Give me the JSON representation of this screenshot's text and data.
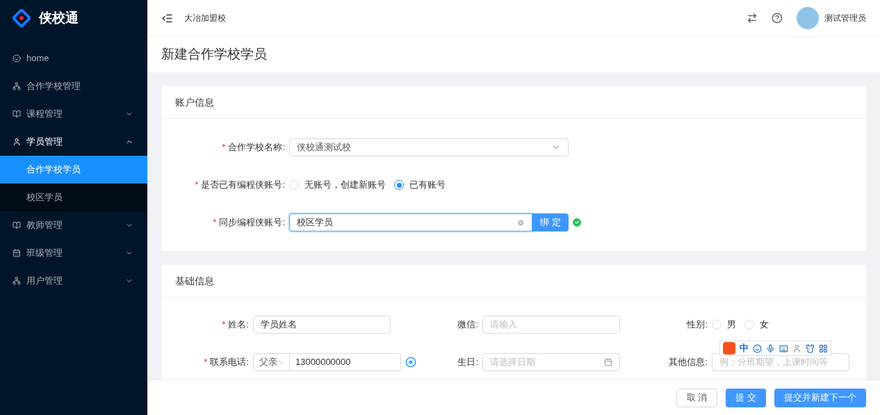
{
  "sidebar": {
    "logo": "侠校通",
    "items": [
      {
        "label": "home",
        "has_children": false,
        "expanded": false,
        "selected": false
      },
      {
        "label": "合作学校管理",
        "has_children": false,
        "expanded": false,
        "selected": false
      },
      {
        "label": "课程管理",
        "has_children": true,
        "expanded": false,
        "selected": false
      },
      {
        "label": "学员管理",
        "has_children": true,
        "expanded": true,
        "selected": false,
        "children": [
          {
            "label": "合作学校学员",
            "selected": true
          },
          {
            "label": "校区学员",
            "selected": false
          }
        ]
      },
      {
        "label": "教师管理",
        "has_children": true,
        "expanded": false,
        "selected": false
      },
      {
        "label": "班级管理",
        "has_children": true,
        "expanded": false,
        "selected": false
      },
      {
        "label": "用户管理",
        "has_children": true,
        "expanded": false,
        "selected": false
      }
    ]
  },
  "header": {
    "school": "大冶加盟校",
    "user": "测试管理员"
  },
  "page_title": "新建合作学校学员",
  "account_card": {
    "title": "账户信息",
    "fields": [
      {
        "kind": "select",
        "label": "合作学校名称:",
        "required_mark": "*",
        "value": "侠校通测试校"
      },
      {
        "kind": "radio",
        "label": "是否已有编程侠账号:",
        "required_mark": "*",
        "options": [
          {
            "label": "无账号，创建新账号",
            "selected": false
          },
          {
            "label": "已有账号",
            "selected": true
          }
        ]
      },
      {
        "kind": "bind",
        "label": "同步编程侠账号:",
        "required_mark": "*",
        "value": "校区学员",
        "button": "绑 定",
        "verified": true
      }
    ]
  },
  "basic_card": {
    "title": "基础信息",
    "fields": [
      {
        "kind": "input",
        "label": "姓名:",
        "required_mark": "*",
        "value": "学员姓名"
      },
      {
        "kind": "input",
        "label": "微信:",
        "placeholder": "请输入"
      },
      {
        "kind": "radio",
        "label": "性别:",
        "options": [
          {
            "label": "男",
            "selected": false
          },
          {
            "label": "女",
            "selected": false
          }
        ]
      },
      {
        "kind": "phone",
        "label": "联系电话:",
        "required_mark": "*",
        "relation": "父亲",
        "value": "13000000000"
      },
      {
        "kind": "date",
        "label": "生日:",
        "placeholder": "请选择日期"
      },
      {
        "kind": "input",
        "label": "其他信息:",
        "placeholder": "例：分班期望，上课时间等"
      }
    ]
  },
  "ime_toolbar": {
    "mode": "中"
  },
  "footer": {
    "buttons": [
      {
        "label": "取 消",
        "kind": "default"
      },
      {
        "label": "提 交",
        "kind": "primary"
      },
      {
        "label": "提交并新建下一个",
        "kind": "primary"
      }
    ]
  }
}
